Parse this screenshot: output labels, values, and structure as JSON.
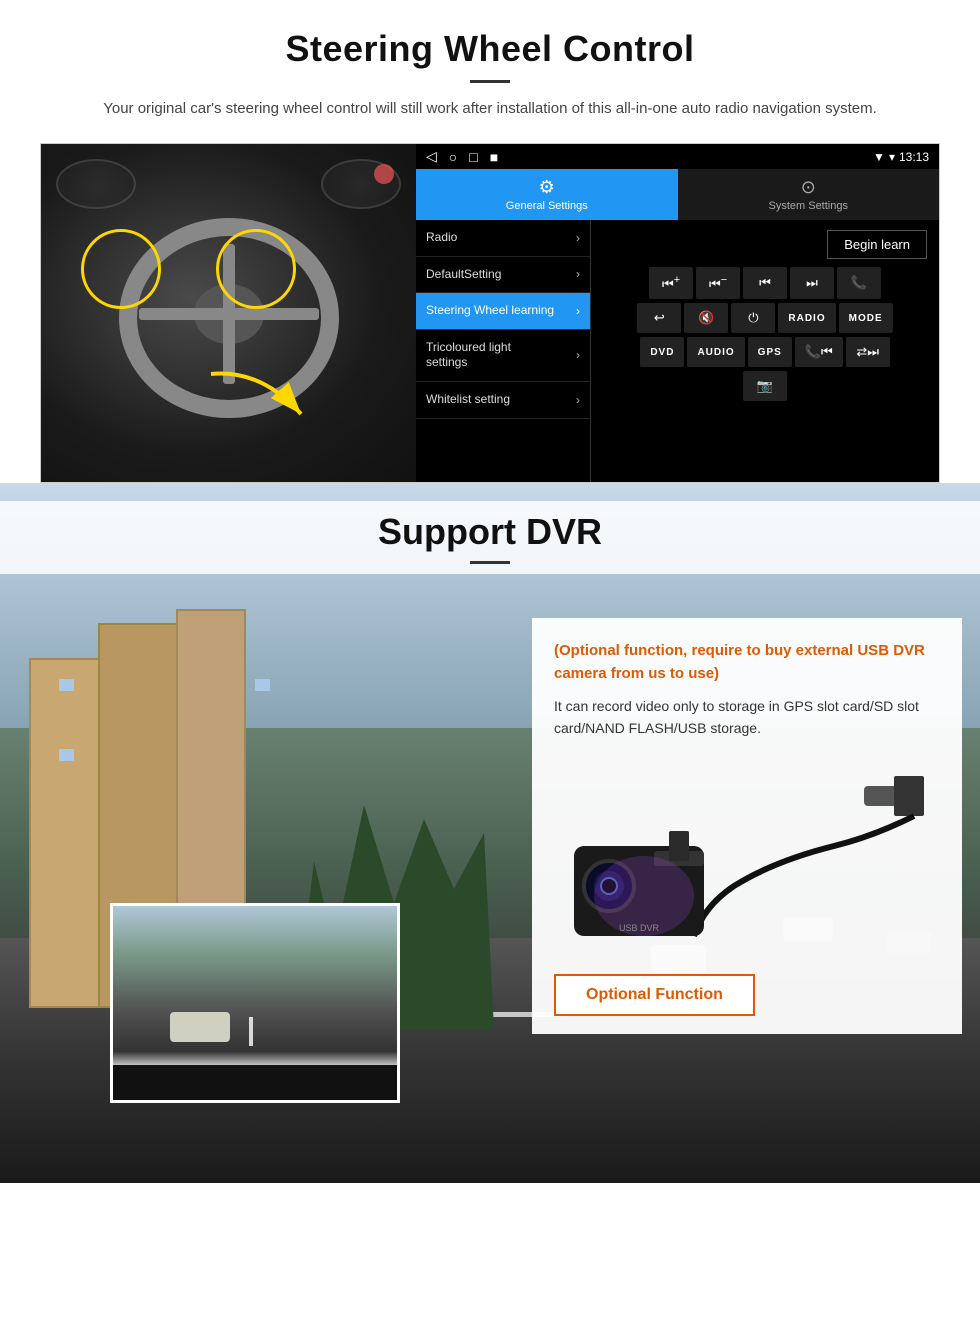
{
  "page": {
    "section1": {
      "title": "Steering Wheel Control",
      "subtitle": "Your original car's steering wheel control will still work after installation of this all-in-one auto radio navigation system.",
      "android_ui": {
        "status_bar": {
          "time": "13:13",
          "nav_icons": [
            "◁",
            "○",
            "□",
            "■"
          ]
        },
        "tabs": [
          {
            "id": "general",
            "label": "General Settings",
            "icon": "⚙",
            "active": true
          },
          {
            "id": "system",
            "label": "System Settings",
            "icon": "🔗",
            "active": false
          }
        ],
        "menu_items": [
          {
            "label": "Radio",
            "active": false
          },
          {
            "label": "DefaultSetting",
            "active": false
          },
          {
            "label": "Steering Wheel learning",
            "active": true
          },
          {
            "label": "Tricoloured light settings",
            "active": false
          },
          {
            "label": "Whitelist setting",
            "active": false
          }
        ],
        "begin_learn_label": "Begin learn",
        "control_buttons_row1": [
          "⏮+",
          "⏮–",
          "⏮",
          "⏭",
          "📞"
        ],
        "control_buttons_row2": [
          "↩",
          "🔇",
          "⏻",
          "RADIO",
          "MODE"
        ],
        "control_buttons_row3": [
          "DVD",
          "AUDIO",
          "GPS",
          "📞⏮",
          "🔀⏭"
        ],
        "control_buttons_row4": [
          "📷"
        ]
      }
    },
    "section2": {
      "title": "Support DVR",
      "optional_text": "(Optional function, require to buy external USB DVR camera from us to use)",
      "description": "It can record video only to storage in GPS slot card/SD slot card/NAND FLASH/USB storage.",
      "optional_function_label": "Optional Function"
    }
  }
}
